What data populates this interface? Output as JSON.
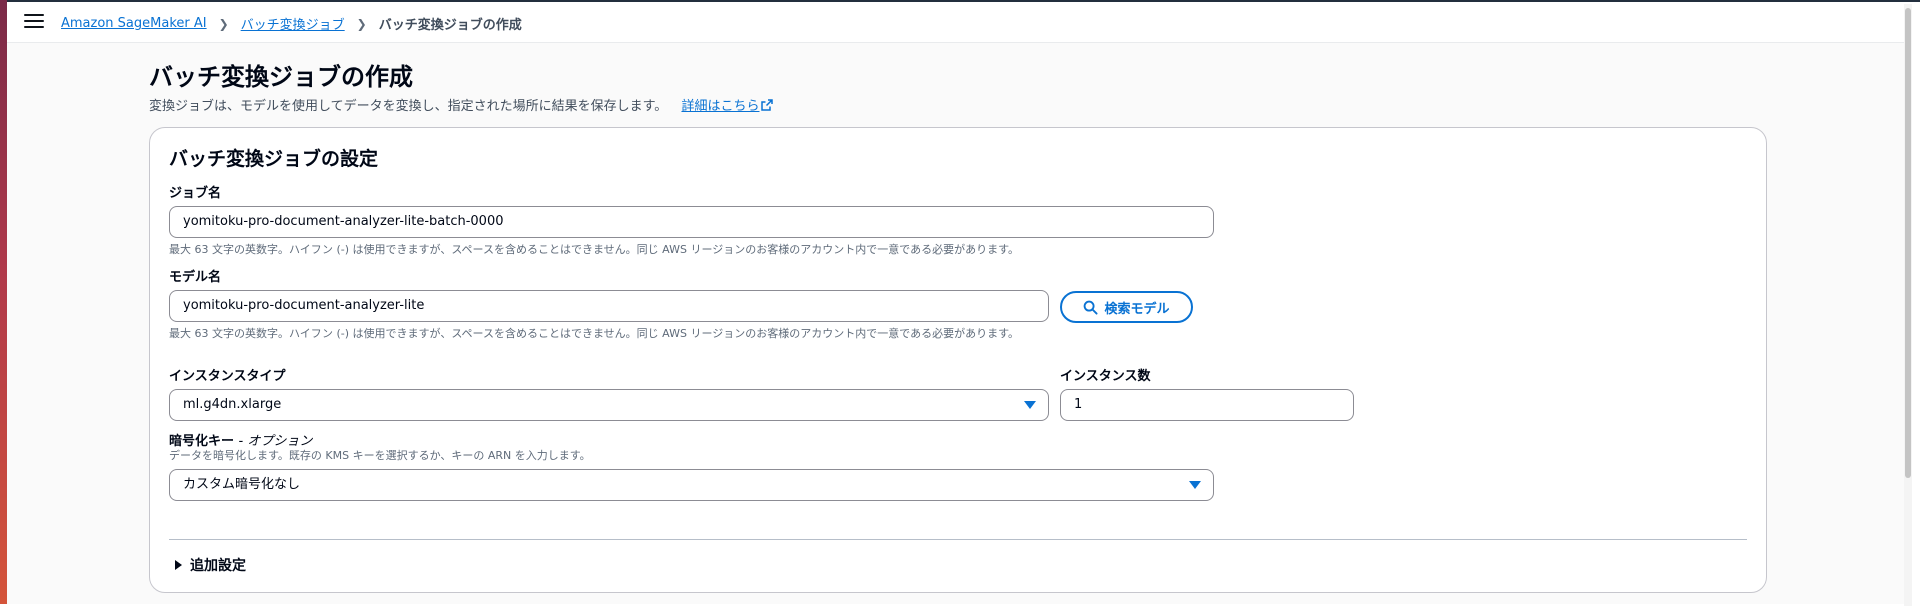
{
  "breadcrumb": {
    "items": [
      "Amazon SageMaker AI",
      "バッチ変換ジョブ"
    ],
    "current": "バッチ変換ジョブの作成"
  },
  "page": {
    "title": "バッチ変換ジョブの作成",
    "description": "変換ジョブは、モデルを使用してデータを変換し、指定された場所に結果を保存します。",
    "learn_more": "詳細はこちら"
  },
  "card": {
    "title": "バッチ変換ジョブの設定",
    "job_name": {
      "label": "ジョブ名",
      "value": "yomitoku-pro-document-analyzer-lite-batch-0000",
      "hint": "最大 63 文字の英数字。ハイフン (-) は使用できますが、スペースを含めることはできません。同じ AWS リージョンのお客様のアカウント内で一意である必要があります。"
    },
    "model_name": {
      "label": "モデル名",
      "value": "yomitoku-pro-document-analyzer-lite",
      "hint": "最大 63 文字の英数字。ハイフン (-) は使用できますが、スペースを含めることはできません。同じ AWS リージョンのお客様のアカウント内で一意である必要があります。",
      "search_button": "検索モデル"
    },
    "instance_type": {
      "label": "インスタンスタイプ",
      "value": "ml.g4dn.xlarge"
    },
    "instance_count": {
      "label": "インスタンス数",
      "value": "1"
    },
    "encryption": {
      "label": "暗号化キー",
      "optional": "- オプション",
      "hint": "データを暗号化します。既存の KMS キーを選択するか、キーの ARN を入力します。",
      "value": "カスタム暗号化なし"
    },
    "additional_settings": "追加設定"
  },
  "colors": {
    "accent": "#0972d3",
    "border": "#8c8c94",
    "text": "#000716"
  }
}
